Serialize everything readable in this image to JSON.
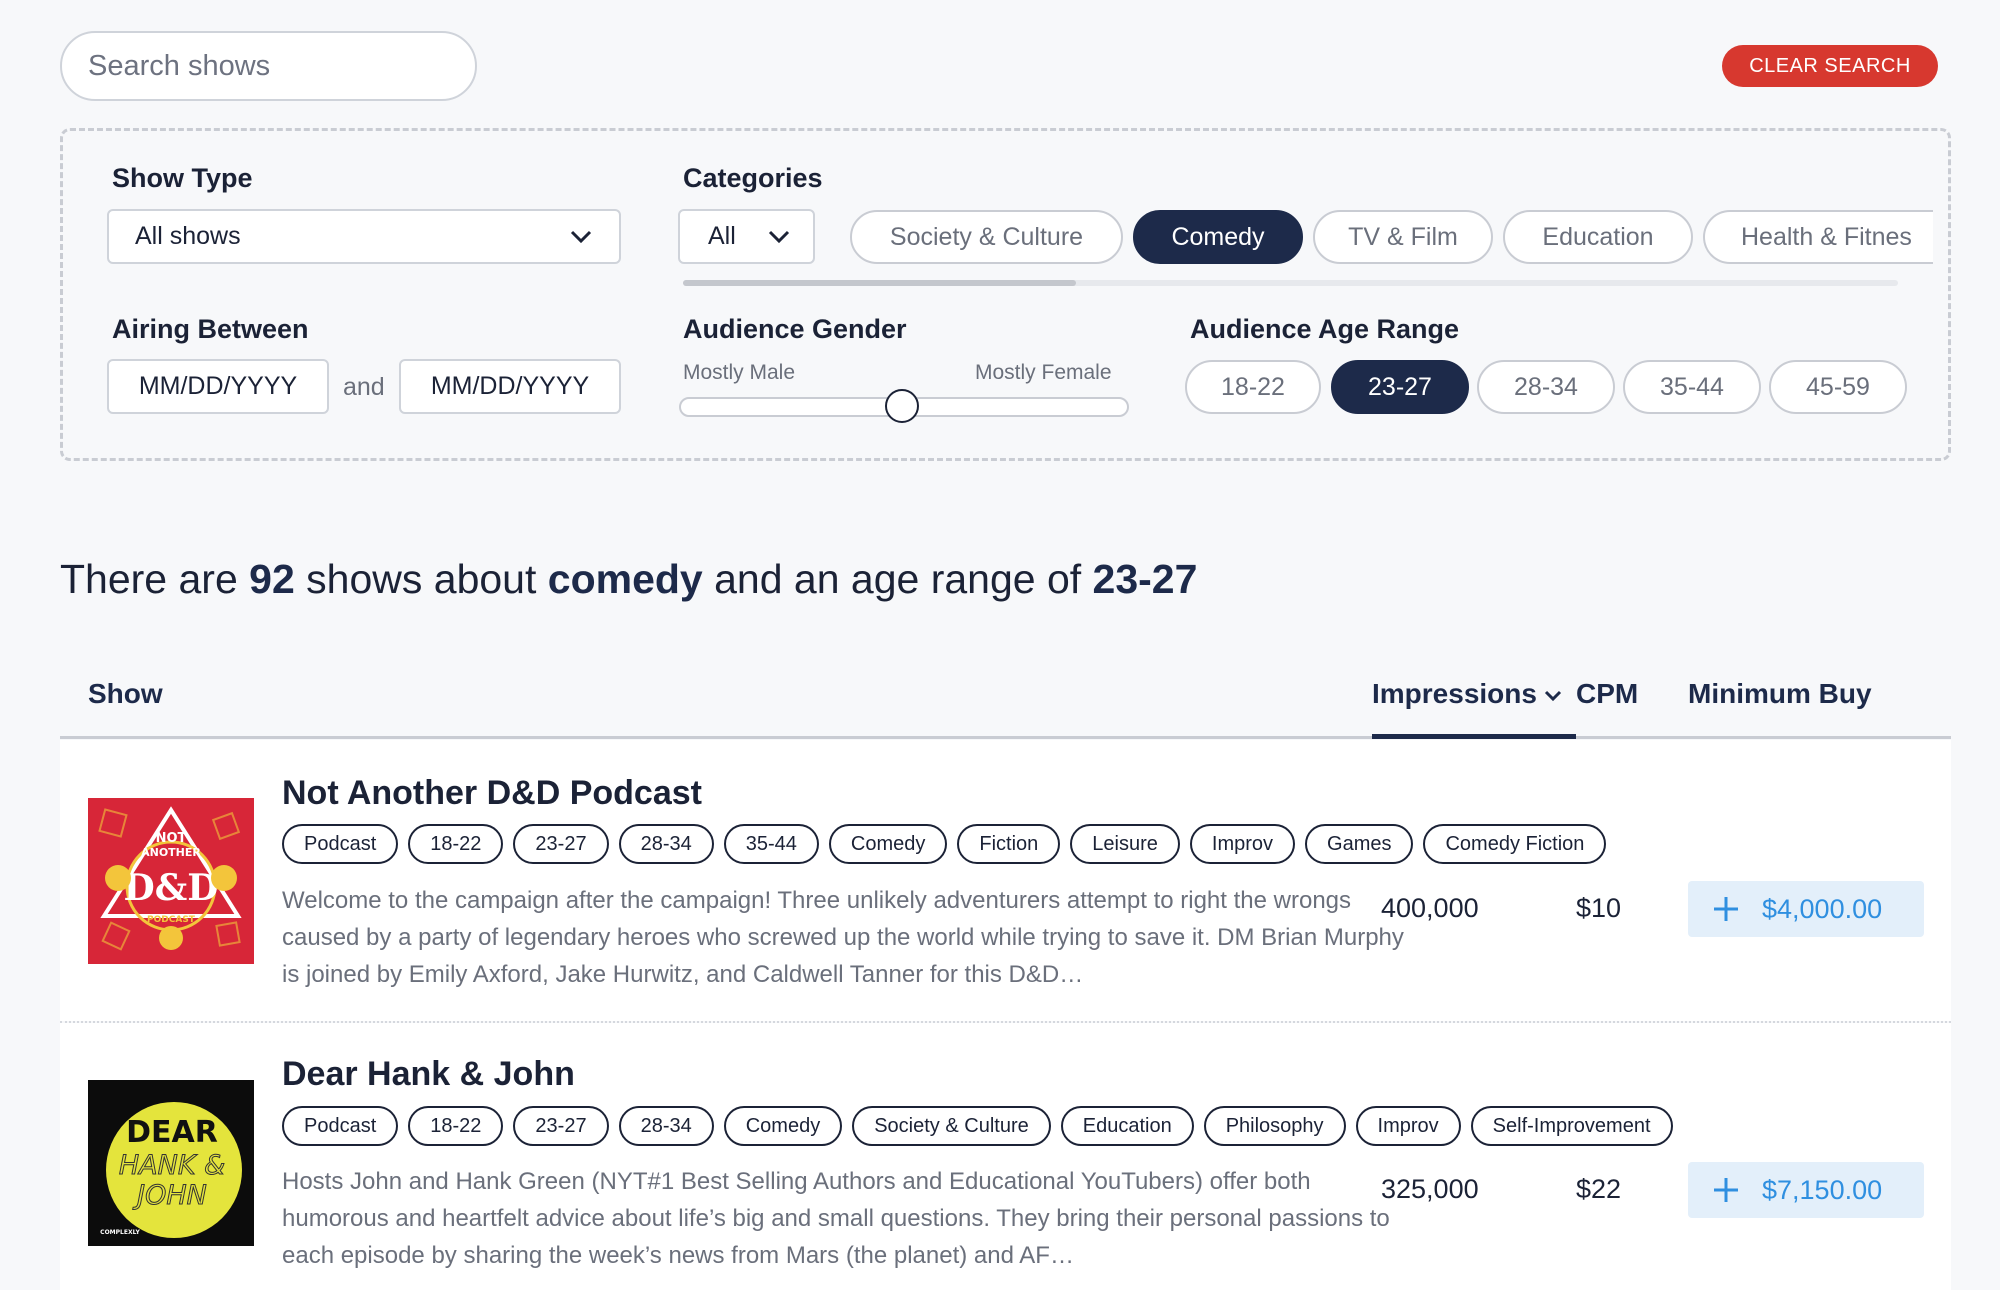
{
  "search": {
    "placeholder": "Search shows"
  },
  "clear_button": "CLEAR SEARCH",
  "filters": {
    "show_type": {
      "label": "Show Type",
      "selected": "All shows"
    },
    "categories": {
      "label": "Categories",
      "selected": "All",
      "chips": [
        {
          "label": "Society & Culture",
          "active": false
        },
        {
          "label": "Comedy",
          "active": true
        },
        {
          "label": "TV & Film",
          "active": false
        },
        {
          "label": "Education",
          "active": false
        },
        {
          "label": "Health & Fitnes",
          "active": false
        }
      ]
    },
    "airing_between": {
      "label": "Airing Between",
      "start_placeholder": "MM/DD/YYYY",
      "and": "and",
      "end_placeholder": "MM/DD/YYYY"
    },
    "audience_gender": {
      "label": "Audience Gender",
      "left": "Mostly Male",
      "right": "Mostly Female",
      "value": 0.5
    },
    "audience_age": {
      "label": "Audience Age Range",
      "chips": [
        {
          "label": "18-22",
          "active": false
        },
        {
          "label": "23-27",
          "active": true
        },
        {
          "label": "28-34",
          "active": false
        },
        {
          "label": "35-44",
          "active": false
        },
        {
          "label": "45-59",
          "active": false
        }
      ]
    }
  },
  "summary": {
    "p1": "There are ",
    "count": "92",
    "p2": " shows about ",
    "topic": "comedy",
    "p3": " and an age range of ",
    "age": "23-27"
  },
  "table": {
    "headers": {
      "show": "Show",
      "impressions": "Impressions",
      "cpm": "CPM",
      "min_buy": "Minimum Buy"
    },
    "rows": [
      {
        "title": "Not Another D&D Podcast",
        "tags": [
          "Podcast",
          "18-22",
          "23-27",
          "28-34",
          "35-44",
          "Comedy",
          "Fiction",
          "Leisure",
          "Improv",
          "Games",
          "Comedy Fiction"
        ],
        "description": "Welcome to the campaign after the campaign! Three unlikely adventurers attempt to right the wrongs caused by a party of legendary heroes who screwed up the world while trying to save it. DM Brian Murphy is joined by Emily Axford, Jake Hurwitz, and Caldwell Tanner for this D&D…",
        "impressions": "400,000",
        "cpm": "$10",
        "min_buy": "$4,000.00",
        "art": {
          "line1": "NOT",
          "line2": "ANOTHER",
          "line3": "D&D",
          "line4": "PODCAST"
        }
      },
      {
        "title": "Dear Hank & John",
        "tags": [
          "Podcast",
          "18-22",
          "23-27",
          "28-34",
          "Comedy",
          "Society & Culture",
          "Education",
          "Philosophy",
          "Improv",
          "Self-Improvement"
        ],
        "description": "Hosts John and Hank Green (NYT#1 Best Selling Authors and Educational YouTubers) offer both humorous and heartfelt advice about life’s big and small questions. They bring their personal passions to each episode by sharing the week’s news from Mars (the planet) and AF…",
        "impressions": "325,000",
        "cpm": "$22",
        "min_buy": "$7,150.00",
        "art": {
          "line1": "DEAR",
          "line2": "HANK &",
          "line3": "JOHN",
          "line4": "COMPLEXLY"
        }
      }
    ]
  },
  "colors": {
    "navy": "#1d2a4a",
    "clear_red": "#d7382f",
    "buy_bg": "#e3effa",
    "buy_text": "#2f8fe0"
  }
}
